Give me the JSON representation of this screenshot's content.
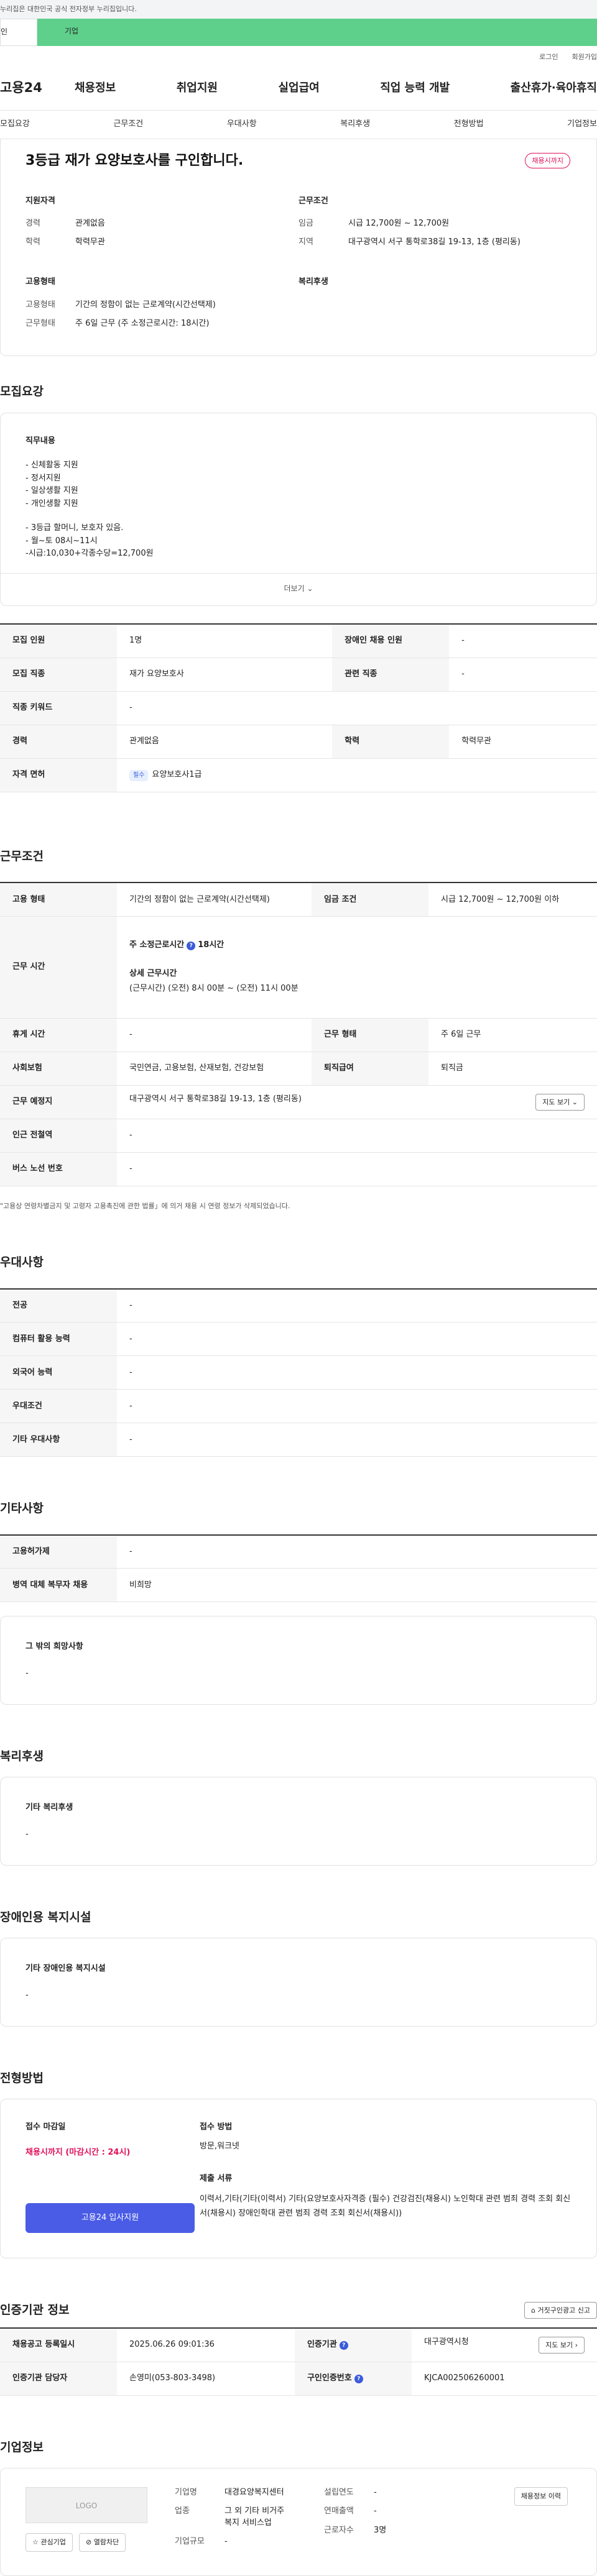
{
  "gov_notice": "누리집은 대한민국 공식 전자정부 누리집입니다.",
  "top_tabs": [
    "인",
    "기업"
  ],
  "util_links": [
    "로그인",
    "회원가입"
  ],
  "logo": "고용24",
  "gnb": [
    "채용정보",
    "취업지원",
    "실업급여",
    "직업 능력 개발",
    "출산휴가·육아휴직"
  ],
  "anchors": [
    "모집요강",
    "근무조건",
    "우대사항",
    "복리후생",
    "전형방법",
    "기업정보"
  ],
  "summary": {
    "title": "3등급 재가 요양보호사를 구인합니다.",
    "badge": "채용시까지",
    "qual_h": "지원자격",
    "cond_h": "근무조건",
    "career_k": "경력",
    "career_v": "관계없음",
    "edu_k": "학력",
    "edu_v": "학력무관",
    "wage_k": "임금",
    "wage_v": "시급 12,700원 ~ 12,700원",
    "region_k": "지역",
    "region_v": "대구광역시 서구 통학로38길 19-13, 1층 (평리동)",
    "emp_h": "고용형태",
    "welfare_h": "복리후생",
    "emptype_k": "고용형태",
    "emptype_v": "기간의 정함이 없는 근로계약(시간선택제)",
    "worktype_k": "근무형태",
    "worktype_v": "주 6일 근무 (주 소정근로시간: 18시간)"
  },
  "recruit": {
    "section": "모집요강",
    "job_h": "직무내용",
    "lines": [
      "- 신체활동 지원",
      "- 정서지원",
      "- 일상생활 지원",
      "- 개인생활 지원",
      "",
      "- 3등급 할머니, 보호자 있음.",
      "- 월~토  08시~11시",
      "-시급:10,030+각종수당=12,700원"
    ],
    "more": "더보기",
    "rows": [
      [
        "모집 인원",
        "1명",
        "장애인 채용 인원",
        "-"
      ],
      [
        "모집 직종",
        "재가 요양보호사",
        "관련 직종",
        "-"
      ],
      [
        "직종 키워드",
        "-"
      ],
      [
        "경력",
        "관계없음",
        "학력",
        "학력무관"
      ],
      [
        "자격 면허",
        "요양보호사1급"
      ]
    ],
    "pill": "필수"
  },
  "work": {
    "section": "근무조건",
    "emp_k": "고용 형태",
    "emp_v": "기간의 정함이 없는 근로계약(시간선택제)",
    "wage_k": "임금 조건",
    "wage_v": "시급 12,700원 ~ 12,700원 이하",
    "time_k": "근무 시간",
    "weekly_label": "주 소정근로시간",
    "weekly_v": "18시간",
    "detail_label": "상세 근무시간",
    "detail_v": "(근무시간) (오전) 8시 00분 ~ (오전) 11시 00분",
    "rest_k": "휴게 시간",
    "rest_v": "-",
    "form_k": "근무 형태",
    "form_v": "주 6일 근무",
    "ins_k": "사회보험",
    "ins_v": "국민연금, 고용보험, 산재보험, 건강보험",
    "sev_k": "퇴직급여",
    "sev_v": "퇴직금",
    "place_k": "근무 예정지",
    "place_v": "대구광역시 서구 통학로38길 19-13, 1층 (평리동)",
    "map": "지도 보기",
    "subway_k": "인근 전철역",
    "subway_v": "-",
    "bus_k": "버스 노선 번호",
    "bus_v": "-",
    "note": "\"고용상 연령차별금지 및 고령자 고용촉진에 관한 법률」에 의거 채용 시 연령 정보가 삭제되었습니다."
  },
  "prefer": {
    "section": "우대사항",
    "rows": [
      [
        "전공",
        "-"
      ],
      [
        "컴퓨터 활용 능력",
        "-"
      ],
      [
        "외국어 능력",
        "-"
      ],
      [
        "우대조건",
        "-"
      ],
      [
        "기타 우대사항",
        "-"
      ]
    ]
  },
  "etc": {
    "section": "기타사항",
    "rows": [
      [
        "고용허가제",
        "-"
      ],
      [
        "병역 대체 복무자 채용",
        "비희망"
      ]
    ],
    "box_h": "그 밖의 희망사항",
    "box_v": "-"
  },
  "welfare": {
    "section": "복리후생",
    "box_h": "기타 복리후생",
    "box_v": "-"
  },
  "disabled": {
    "section": "장애인용 복지시설",
    "box_h": "기타 장애인용 복지시설",
    "box_v": "-"
  },
  "selection": {
    "section": "전형방법",
    "deadline_h": "접수 마감일",
    "deadline_v": "채용시까지 (마감시간 : 24시)",
    "method_h": "접수 방법",
    "method_v": "방문,워크넷",
    "docs_h": "제출 서류",
    "docs_v": "이력서,기타(기타(이력서) 기타(요양보호사자격증 (필수) 건강검진(채용시) 노인학대 관련 범죄 경력 조회 회신서(채용시) 장애인학대 관련 범죄 경력 조회 회신서(채용시))",
    "apply_btn": "고용24 입사지원"
  },
  "cert": {
    "section": "인증기관 정보",
    "report_btn": "거짓구인광고 신고",
    "reg_k": "채용공고 등록일시",
    "reg_v": "2025.06.26 09:01:36",
    "org_k": "인증기관",
    "org_v": "대구광역시청",
    "map": "지도 보기",
    "mgr_k": "인증기관 담당자",
    "mgr_v": "손영미(053-803-3498)",
    "id_k": "구인인증번호",
    "id_v": "KJCA002506260001"
  },
  "company": {
    "section": "기업정보",
    "logo": "LOGO",
    "fav_btn": "관심기업",
    "block_btn": "열람차단",
    "name_k": "기업명",
    "name_v": "대경요양복지센터",
    "year_k": "설립연도",
    "year_v": "-",
    "ind_k": "업종",
    "ind_v": "그 외 기타 비거주 복지 서비스업",
    "sales_k": "연매출액",
    "sales_v": "-",
    "emp_k": "근로자수",
    "emp_v": "3명",
    "size_k": "기업규모",
    "size_v": "-",
    "history_btn": "채용정보 이력"
  }
}
